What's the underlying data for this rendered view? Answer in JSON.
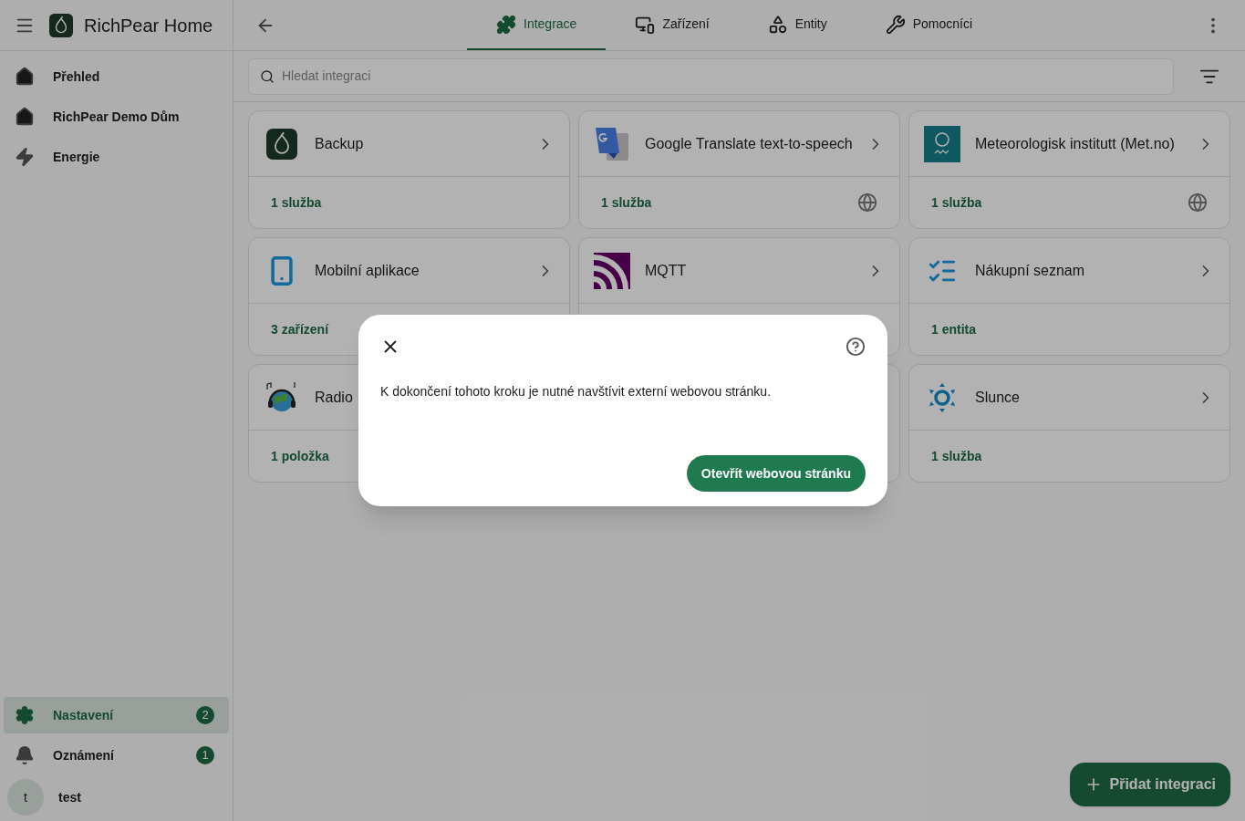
{
  "app": {
    "title": "RichPear Home"
  },
  "sidebar": {
    "items": [
      {
        "label": "Přehled",
        "selected": false
      },
      {
        "label": "RichPear Demo Dům",
        "selected": false
      },
      {
        "label": "Energie",
        "selected": false
      }
    ],
    "bottom_items": [
      {
        "label": "Nastavení",
        "badge": "2",
        "selected": true
      },
      {
        "label": "Oznámení",
        "badge": "1",
        "selected": false
      }
    ],
    "user": {
      "initial": "t",
      "name": "test"
    }
  },
  "tabs": [
    {
      "label": "Integrace",
      "selected": true
    },
    {
      "label": "Zařízení",
      "selected": false
    },
    {
      "label": "Entity",
      "selected": false
    },
    {
      "label": "Pomocníci",
      "selected": false
    }
  ],
  "search": {
    "placeholder": "Hledat integraci"
  },
  "cards": [
    {
      "name": "Backup",
      "summary": "1 služba",
      "cloud": false
    },
    {
      "name": "Google Translate text-to-speech",
      "summary": "1 služba",
      "cloud": true
    },
    {
      "name": "Meteorologisk institutt (Met.no)",
      "summary": "1 služba",
      "cloud": true
    },
    {
      "name": "Mobilní aplikace",
      "summary": "3 zařízení"
    },
    {
      "name": "MQTT"
    },
    {
      "name": "Nákupní seznam",
      "summary": "1 entita",
      "cloud": false
    },
    {
      "name": "Radio",
      "summary": "1 položka"
    },
    {
      "kind": "hidden"
    },
    {
      "name": "Slunce",
      "summary": "1 služba",
      "cloud": false
    }
  ],
  "fab": {
    "label": "Přidat integraci"
  },
  "dialog": {
    "message": "K dokončení tohoto kroku je nutné navštívit externí webovou stránku.",
    "button": "Otevřít webovou stránku"
  }
}
